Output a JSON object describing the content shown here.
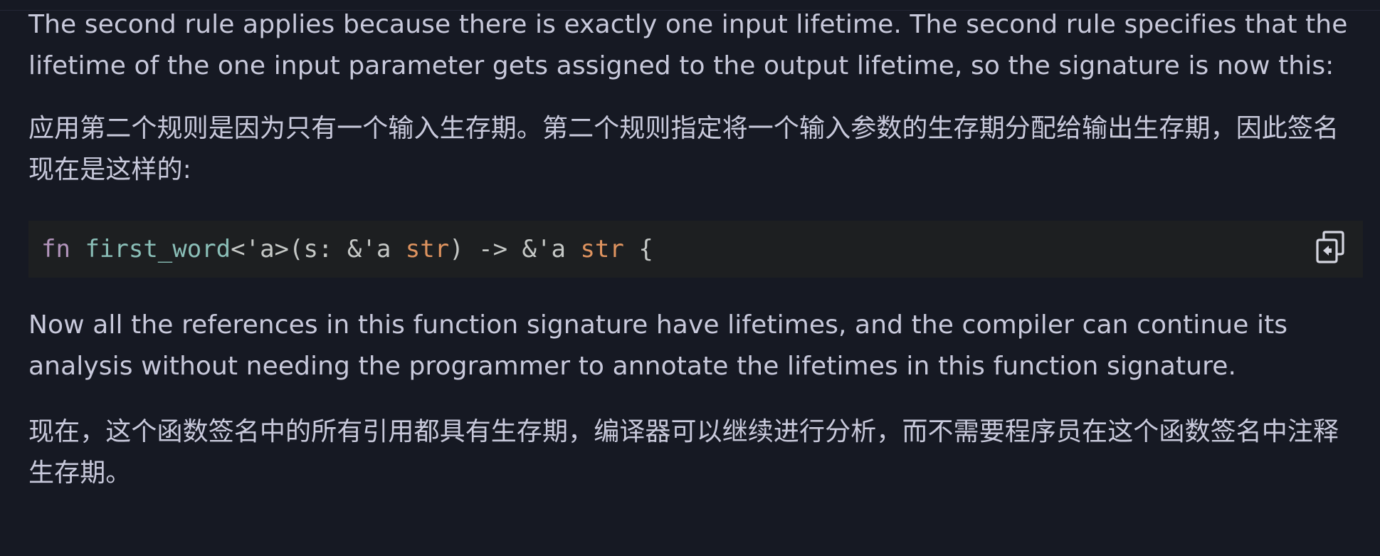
{
  "paragraphs": {
    "en1": "The second rule applies because there is exactly one input lifetime. The second rule specifies that the lifetime of the one input parameter gets assigned to the output lifetime, so the signature is now this:",
    "zh1": "应用第二个规则是因为只有一个输入生存期。第二个规则指定将一个输入参数的生存期分配给输出生存期，因此签名现在是这样的:",
    "en2": "Now all the references in this function signature have lifetimes, and the compiler can continue its analysis without needing the programmer to annotate the lifetimes in this function signature.",
    "zh2": "现在，这个函数签名中的所有引用都具有生存期，编译器可以继续进行分析，而不需要程序员在这个函数签名中注释生存期。"
  },
  "code": {
    "tokens": {
      "t1": "fn",
      "t2": " ",
      "t3": "first_word",
      "t4": "<'a>(s: &'a ",
      "t5": "str",
      "t6": ") -> &'a ",
      "t7": "str",
      "t8": " {"
    },
    "copy_icon": "copy-icon"
  },
  "colors": {
    "background": "#161923",
    "text": "#c8c9db",
    "code_background": "#1d1f21",
    "keyword": "#b294bb",
    "function_name": "#8abeb7",
    "type": "#de935f"
  }
}
